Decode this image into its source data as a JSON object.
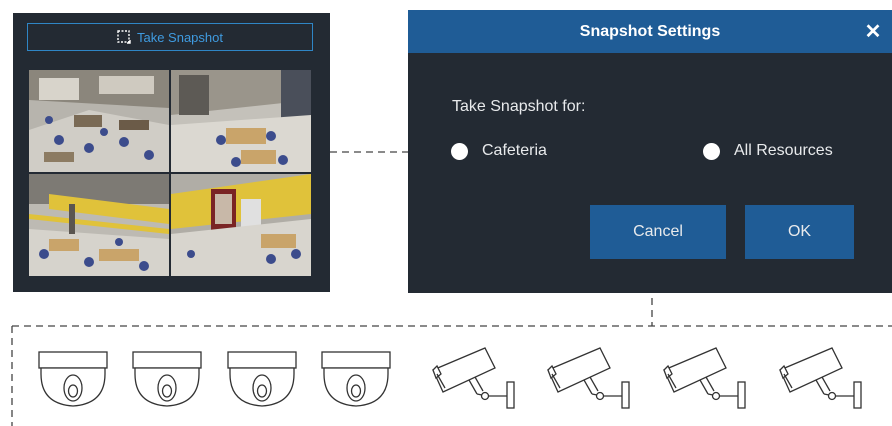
{
  "camera_panel": {
    "snapshot_button_label": "Take Snapshot"
  },
  "dialog": {
    "title": "Snapshot Settings",
    "close_symbol": "✕",
    "prompt": "Take Snapshot for:",
    "options": [
      {
        "label": "Cafeteria"
      },
      {
        "label": "All Resources"
      }
    ],
    "cancel_label": "Cancel",
    "ok_label": "OK"
  },
  "devices": {
    "dome_cameras": [
      "dome-camera-icon",
      "dome-camera-icon",
      "dome-camera-icon",
      "dome-camera-icon"
    ],
    "bullet_cameras": [
      "bullet-camera-icon",
      "bullet-camera-icon",
      "bullet-camera-icon",
      "bullet-camera-icon"
    ]
  },
  "colors": {
    "panel_bg": "#232a33",
    "accent": "#1f5c96",
    "button_outline": "#2f86c6"
  }
}
